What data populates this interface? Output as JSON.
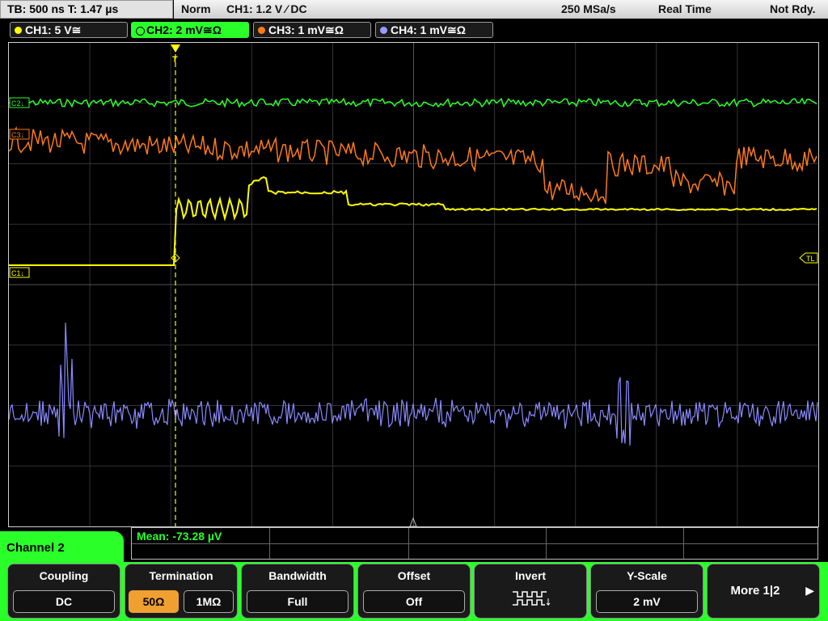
{
  "status": {
    "timebase": "TB: 500 ns   T: 1.47 µs",
    "mode": "Norm",
    "trigger": "CH1: 1.2 V ⁄ DC",
    "sample_rate": "250 MSa/s",
    "acq_mode": "Real Time",
    "ready": "Not Rdy."
  },
  "channels": [
    {
      "label": "CH1: 5 V≅",
      "color": "#ffff00",
      "active": false
    },
    {
      "label": "CH2: 2 mV≅Ω",
      "color": "#2aff2a",
      "active": true
    },
    {
      "label": "CH3: 1 mV≅Ω",
      "color": "#ff7a1a",
      "active": false
    },
    {
      "label": "CH4: 1 mV≅Ω",
      "color": "#9a9aff",
      "active": false
    }
  ],
  "markers": {
    "c2": "C2↓",
    "c3": "C3↓",
    "c1": "C1↓",
    "tl": "TL",
    "trigger_t": "T"
  },
  "measurement": {
    "mean": "Mean: -73.28 µV"
  },
  "menu": {
    "channel_title": "Channel 2"
  },
  "softkeys": {
    "coupling": {
      "title": "Coupling",
      "value": "DC"
    },
    "termination": {
      "title": "Termination",
      "opt1": "50Ω",
      "opt2": "1MΩ"
    },
    "bandwidth": {
      "title": "Bandwidth",
      "value": "Full"
    },
    "offset": {
      "title": "Offset",
      "value": "Off"
    },
    "invert": {
      "title": "Invert",
      "icon": "invert-waveform-icon"
    },
    "yscale": {
      "title": "Y-Scale",
      "value": "2 mV"
    },
    "more": {
      "label": "More 1|2"
    }
  }
}
